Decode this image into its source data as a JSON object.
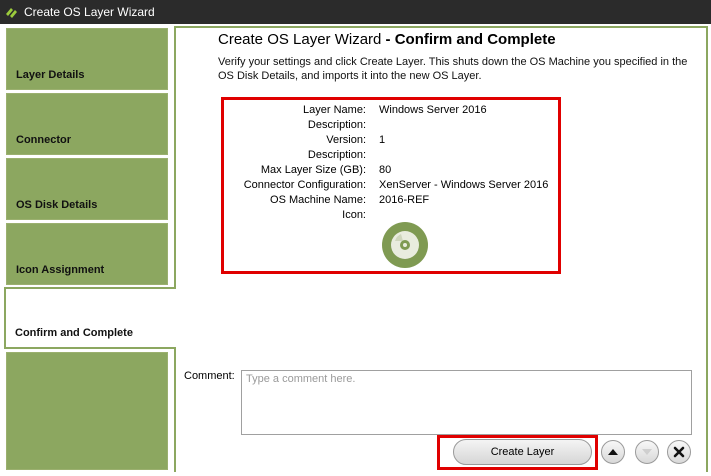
{
  "window": {
    "title": "Create OS Layer Wizard"
  },
  "nav": [
    {
      "label": "Layer Details"
    },
    {
      "label": "Connector"
    },
    {
      "label": "OS Disk Details"
    },
    {
      "label": "Icon Assignment"
    },
    {
      "label": "Confirm and Complete"
    },
    {
      "label": ""
    }
  ],
  "page": {
    "title_prefix": "Create OS Layer Wizard",
    "title_suffix": " - Confirm and Complete",
    "description": "Verify your settings and click Create Layer. This shuts down the OS Machine you specified in the OS Disk Details, and imports it into the new OS Layer."
  },
  "summary": {
    "layer_name_label": "Layer Name:",
    "layer_name": "Windows Server 2016",
    "description1_label": "Description:",
    "description1": "",
    "version_label": "Version:",
    "version": "1",
    "description2_label": "Description:",
    "description2": "",
    "max_size_label": "Max Layer Size (GB):",
    "max_size": "80",
    "connector_label": "Connector Configuration:",
    "connector": "XenServer - Windows Server 2016",
    "machine_label": "OS Machine Name:",
    "machine": "2016-REF",
    "icon_label": "Icon:",
    "icon": "disc-icon"
  },
  "comment": {
    "label": "Comment:",
    "value": "",
    "placeholder": "Type a comment here."
  },
  "actions": {
    "create_label": "Create Layer",
    "up_icon": "arrow-up-icon",
    "down_icon": "arrow-down-icon",
    "close_icon": "close-icon"
  },
  "colors": {
    "accent_green": "#8ca760",
    "highlight_red": "#e00000",
    "titlebar": "#2b2b2b"
  }
}
